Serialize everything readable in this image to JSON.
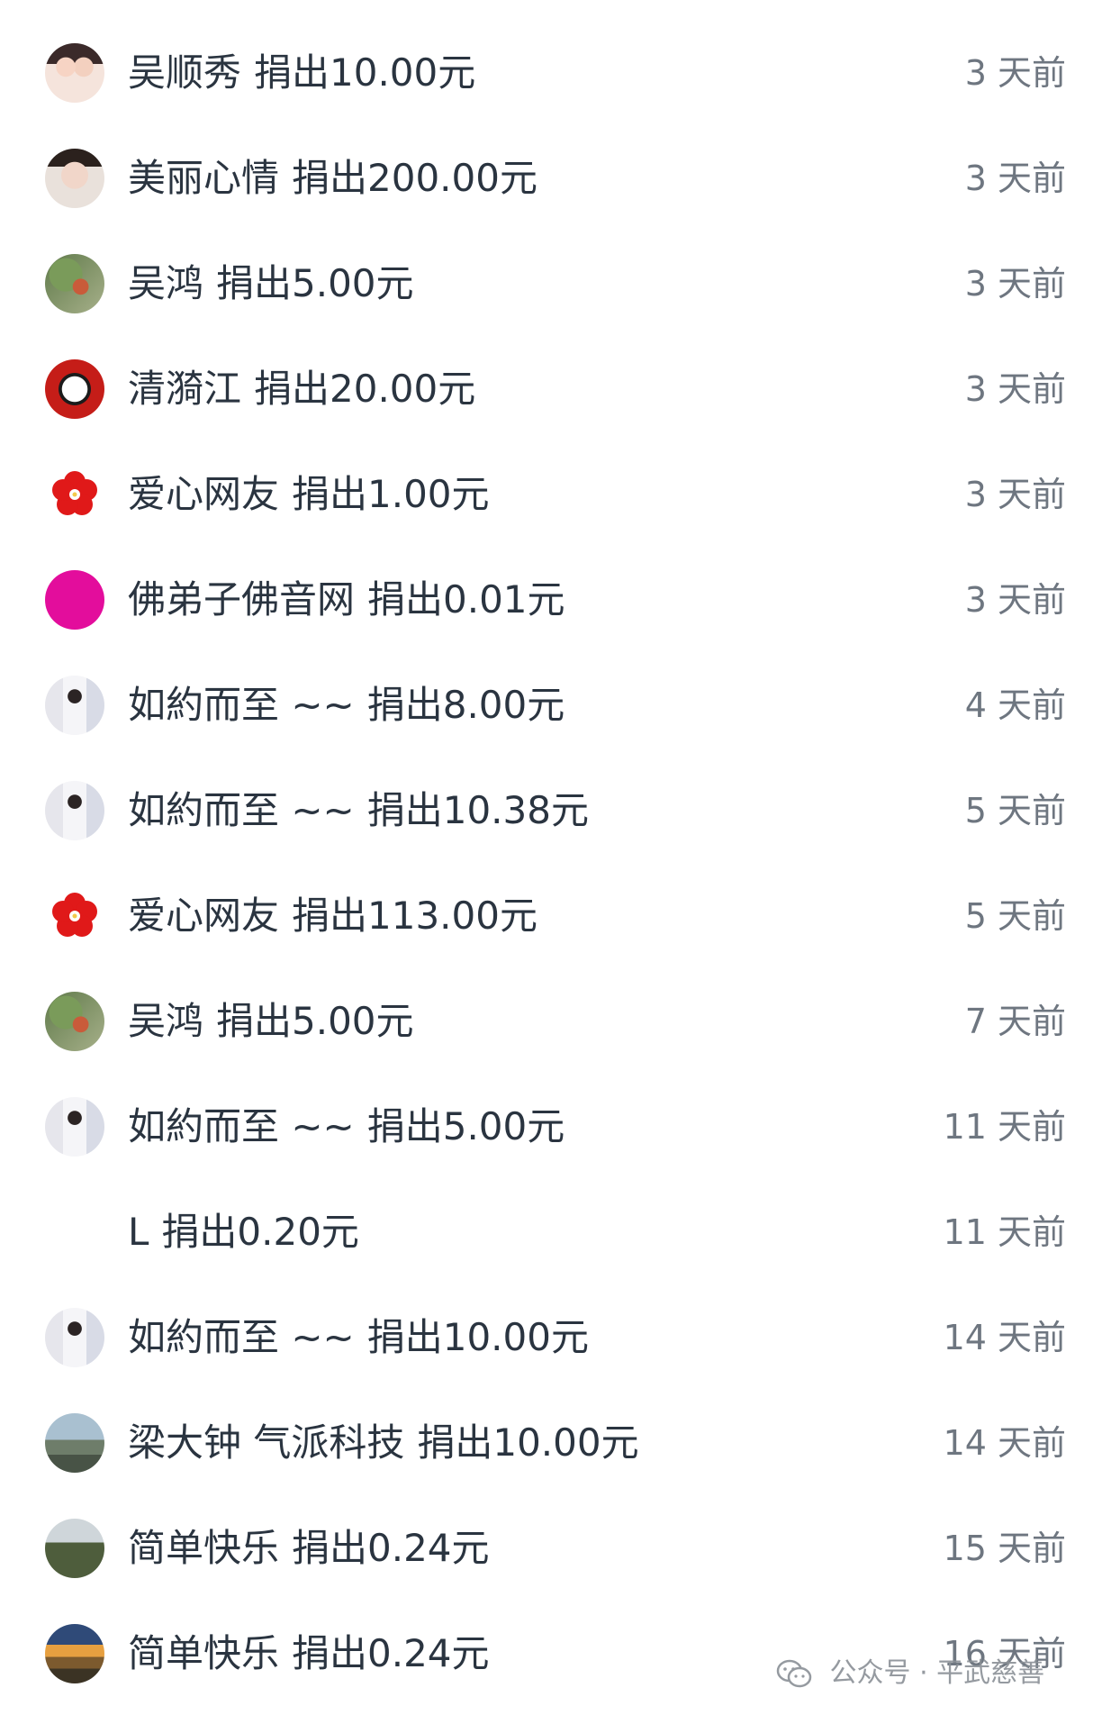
{
  "donations": [
    {
      "name": "吴顺秀",
      "action": "捐出10.00元",
      "time": "3 天前",
      "avatar": "av-cartoon"
    },
    {
      "name": "美丽心情",
      "action": "捐出200.00元",
      "time": "3 天前",
      "avatar": "av-woman"
    },
    {
      "name": "吴鸿",
      "action": "捐出5.00元",
      "time": "3 天前",
      "avatar": "av-garden"
    },
    {
      "name": "清漪江",
      "action": "捐出20.00元",
      "time": "3 天前",
      "avatar": "av-panda"
    },
    {
      "name": "爱心网友",
      "action": "捐出1.00元",
      "time": "3 天前",
      "avatar": "av-flower"
    },
    {
      "name": "佛弟子佛音网",
      "action": "捐出0.01元",
      "time": "3 天前",
      "avatar": "av-magenta"
    },
    {
      "name": "如約而至 ~~",
      "action": "捐出8.00元",
      "time": "4 天前",
      "avatar": "av-girl"
    },
    {
      "name": "如約而至 ~~",
      "action": "捐出10.38元",
      "time": "5 天前",
      "avatar": "av-girl"
    },
    {
      "name": "爱心网友",
      "action": "捐出113.00元",
      "time": "5 天前",
      "avatar": "av-flower"
    },
    {
      "name": "吴鸿",
      "action": "捐出5.00元",
      "time": "7 天前",
      "avatar": "av-garden"
    },
    {
      "name": "如約而至 ~~",
      "action": "捐出5.00元",
      "time": "11 天前",
      "avatar": "av-girl"
    },
    {
      "name": "L",
      "action": "捐出0.20元",
      "time": "11 天前",
      "avatar": "empty"
    },
    {
      "name": "如約而至 ~~",
      "action": "捐出10.00元",
      "time": "14 天前",
      "avatar": "av-girl"
    },
    {
      "name": "梁大钟 气派科技",
      "action": "捐出10.00元",
      "time": "14 天前",
      "avatar": "av-city"
    },
    {
      "name": "简单快乐",
      "action": "捐出0.24元",
      "time": "15 天前",
      "avatar": "av-hill"
    },
    {
      "name": "简单快乐",
      "action": "捐出0.24元",
      "time": "16 天前",
      "avatar": "av-sunset"
    }
  ],
  "watermark": {
    "text": "公众号 · 平武慈善",
    "icon": "wechat-icon"
  },
  "colors": {
    "name_text": "#2a3440",
    "time_text": "#6e7680",
    "flower_red": "#e01919",
    "magenta": "#e30d9c"
  }
}
